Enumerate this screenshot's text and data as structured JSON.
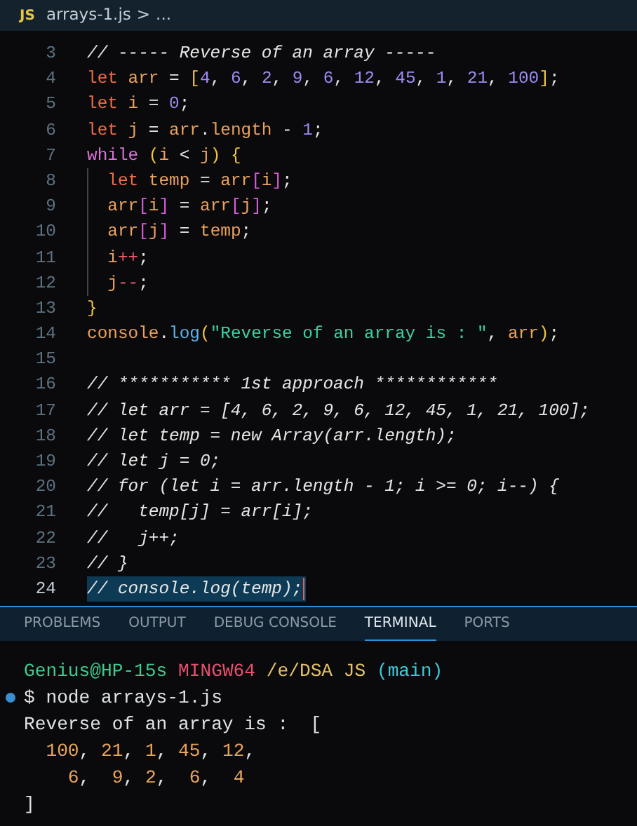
{
  "breadcrumb": {
    "file_icon": "JS",
    "file": "arrays-1.js",
    "separator": ">",
    "more": "..."
  },
  "editor": {
    "lines": [
      {
        "number": "3",
        "tokens": [
          {
            "kind": "comment",
            "text": "// ----- Reverse of an array -----"
          }
        ]
      },
      {
        "number": "4",
        "tokens": [
          {
            "kind": "keyword",
            "text": "let"
          },
          {
            "kind": "variable",
            "text": " arr"
          },
          {
            "kind": "plain",
            "text": " = "
          },
          {
            "kind": "bracket1",
            "text": "["
          },
          {
            "kind": "number",
            "text": "4"
          },
          {
            "kind": "plain",
            "text": ", "
          },
          {
            "kind": "number",
            "text": "6"
          },
          {
            "kind": "plain",
            "text": ", "
          },
          {
            "kind": "number",
            "text": "2"
          },
          {
            "kind": "plain",
            "text": ", "
          },
          {
            "kind": "number",
            "text": "9"
          },
          {
            "kind": "plain",
            "text": ", "
          },
          {
            "kind": "number",
            "text": "6"
          },
          {
            "kind": "plain",
            "text": ", "
          },
          {
            "kind": "number",
            "text": "12"
          },
          {
            "kind": "plain",
            "text": ", "
          },
          {
            "kind": "number",
            "text": "45"
          },
          {
            "kind": "plain",
            "text": ", "
          },
          {
            "kind": "number",
            "text": "1"
          },
          {
            "kind": "plain",
            "text": ", "
          },
          {
            "kind": "number",
            "text": "21"
          },
          {
            "kind": "plain",
            "text": ", "
          },
          {
            "kind": "number",
            "text": "100"
          },
          {
            "kind": "bracket1",
            "text": "]"
          },
          {
            "kind": "plain",
            "text": ";"
          }
        ]
      },
      {
        "number": "5",
        "tokens": [
          {
            "kind": "keyword",
            "text": "let"
          },
          {
            "kind": "variable",
            "text": " i"
          },
          {
            "kind": "plain",
            "text": " = "
          },
          {
            "kind": "number",
            "text": "0"
          },
          {
            "kind": "plain",
            "text": ";"
          }
        ]
      },
      {
        "number": "6",
        "tokens": [
          {
            "kind": "keyword",
            "text": "let"
          },
          {
            "kind": "variable",
            "text": " j"
          },
          {
            "kind": "plain",
            "text": " = "
          },
          {
            "kind": "variable",
            "text": "arr"
          },
          {
            "kind": "plain",
            "text": "."
          },
          {
            "kind": "variable",
            "text": "length"
          },
          {
            "kind": "plain",
            "text": " - "
          },
          {
            "kind": "number",
            "text": "1"
          },
          {
            "kind": "plain",
            "text": ";"
          }
        ]
      },
      {
        "number": "7",
        "tokens": [
          {
            "kind": "control",
            "text": "while"
          },
          {
            "kind": "bracket1",
            "text": " ("
          },
          {
            "kind": "variable",
            "text": "i"
          },
          {
            "kind": "plain",
            "text": " < "
          },
          {
            "kind": "variable",
            "text": "j"
          },
          {
            "kind": "bracket1",
            "text": ")"
          },
          {
            "kind": "bracket1",
            "text": " {"
          }
        ]
      },
      {
        "number": "8",
        "indent_guide": true,
        "tokens": [
          {
            "kind": "keyword",
            "text": "let"
          },
          {
            "kind": "variable",
            "text": " temp"
          },
          {
            "kind": "plain",
            "text": " = "
          },
          {
            "kind": "variable",
            "text": "arr"
          },
          {
            "kind": "bracket2",
            "text": "["
          },
          {
            "kind": "variable",
            "text": "i"
          },
          {
            "kind": "bracket2",
            "text": "]"
          },
          {
            "kind": "plain",
            "text": ";"
          }
        ]
      },
      {
        "number": "9",
        "indent_guide": true,
        "tokens": [
          {
            "kind": "variable",
            "text": "arr"
          },
          {
            "kind": "bracket2",
            "text": "["
          },
          {
            "kind": "variable",
            "text": "i"
          },
          {
            "kind": "bracket2",
            "text": "]"
          },
          {
            "kind": "plain",
            "text": " = "
          },
          {
            "kind": "variable",
            "text": "arr"
          },
          {
            "kind": "bracket2",
            "text": "["
          },
          {
            "kind": "variable",
            "text": "j"
          },
          {
            "kind": "bracket2",
            "text": "]"
          },
          {
            "kind": "plain",
            "text": ";"
          }
        ]
      },
      {
        "number": "10",
        "indent_guide": true,
        "tokens": [
          {
            "kind": "variable",
            "text": "arr"
          },
          {
            "kind": "bracket2",
            "text": "["
          },
          {
            "kind": "variable",
            "text": "j"
          },
          {
            "kind": "bracket2",
            "text": "]"
          },
          {
            "kind": "plain",
            "text": " = "
          },
          {
            "kind": "variable",
            "text": "temp"
          },
          {
            "kind": "plain",
            "text": ";"
          }
        ]
      },
      {
        "number": "11",
        "indent_guide": true,
        "tokens": [
          {
            "kind": "variable",
            "text": "i"
          },
          {
            "kind": "operator",
            "text": "++"
          },
          {
            "kind": "plain",
            "text": ";"
          }
        ]
      },
      {
        "number": "12",
        "indent_guide": true,
        "tokens": [
          {
            "kind": "variable",
            "text": "j"
          },
          {
            "kind": "operator",
            "text": "--"
          },
          {
            "kind": "plain",
            "text": ";"
          }
        ]
      },
      {
        "number": "13",
        "tokens": [
          {
            "kind": "bracket1",
            "text": "}"
          }
        ]
      },
      {
        "number": "14",
        "tokens": [
          {
            "kind": "variable",
            "text": "console"
          },
          {
            "kind": "plain",
            "text": "."
          },
          {
            "kind": "function",
            "text": "log"
          },
          {
            "kind": "bracket1",
            "text": "("
          },
          {
            "kind": "string",
            "text": "\"Reverse of an array is : \""
          },
          {
            "kind": "plain",
            "text": ", "
          },
          {
            "kind": "variable",
            "text": "arr"
          },
          {
            "kind": "bracket1",
            "text": ")"
          },
          {
            "kind": "plain",
            "text": ";"
          }
        ]
      },
      {
        "number": "15"
      },
      {
        "number": "16",
        "tokens": [
          {
            "kind": "comment",
            "text": "// *********** 1st approach ************"
          }
        ]
      },
      {
        "number": "17",
        "tokens": [
          {
            "kind": "comment",
            "text": "// let arr = [4, 6, 2, 9, 6, 12, 45, 1, 21, 100];"
          }
        ]
      },
      {
        "number": "18",
        "tokens": [
          {
            "kind": "comment",
            "text": "// let temp = new Array(arr.length);"
          }
        ]
      },
      {
        "number": "19",
        "tokens": [
          {
            "kind": "comment",
            "text": "// let j = 0;"
          }
        ]
      },
      {
        "number": "20",
        "tokens": [
          {
            "kind": "comment",
            "text": "// for (let i = arr.length - 1; i >= 0; i--) {"
          }
        ]
      },
      {
        "number": "21",
        "tokens": [
          {
            "kind": "comment",
            "text": "//   temp[j] = arr[i];"
          }
        ]
      },
      {
        "number": "22",
        "tokens": [
          {
            "kind": "comment",
            "text": "//   j++;"
          }
        ]
      },
      {
        "number": "23",
        "tokens": [
          {
            "kind": "comment",
            "text": "// }"
          }
        ]
      },
      {
        "number": "24",
        "current": true,
        "tokens": [
          {
            "kind": "comment",
            "text": "// console.log(temp);"
          }
        ]
      }
    ]
  },
  "panel_tabs": [
    {
      "label": "PROBLEMS",
      "selected": false
    },
    {
      "label": "OUTPUT",
      "selected": false
    },
    {
      "label": "DEBUG CONSOLE",
      "selected": false
    },
    {
      "label": "TERMINAL",
      "selected": true
    },
    {
      "label": "PORTS",
      "selected": false
    }
  ],
  "terminal": {
    "lines": [
      {
        "kind": "prompt",
        "segments": [
          {
            "kind": "user",
            "text": "Genius@HP-15s"
          },
          {
            "kind": "host",
            "text": " MINGW64"
          },
          {
            "kind": "path",
            "text": " /e/DSA JS"
          },
          {
            "kind": "branch",
            "text": " (main)"
          }
        ]
      },
      {
        "kind": "command",
        "segments": [
          {
            "kind": "plain",
            "text": "$ node arrays-1.js"
          }
        ]
      },
      {
        "kind": "output",
        "segments": [
          {
            "kind": "plain",
            "text": "Reverse of an array is :  ["
          }
        ]
      },
      {
        "kind": "output",
        "segments": [
          {
            "kind": "number",
            "text": "  100"
          },
          {
            "kind": "plain",
            "text": ", "
          },
          {
            "kind": "number",
            "text": "21"
          },
          {
            "kind": "plain",
            "text": ", "
          },
          {
            "kind": "number",
            "text": "1"
          },
          {
            "kind": "plain",
            "text": ", "
          },
          {
            "kind": "number",
            "text": "45"
          },
          {
            "kind": "plain",
            "text": ", "
          },
          {
            "kind": "number",
            "text": "12"
          },
          {
            "kind": "plain",
            "text": ","
          }
        ]
      },
      {
        "kind": "output",
        "segments": [
          {
            "kind": "number",
            "text": "    6"
          },
          {
            "kind": "plain",
            "text": ",  "
          },
          {
            "kind": "number",
            "text": "9"
          },
          {
            "kind": "plain",
            "text": ", "
          },
          {
            "kind": "number",
            "text": "2"
          },
          {
            "kind": "plain",
            "text": ",  "
          },
          {
            "kind": "number",
            "text": "6"
          },
          {
            "kind": "plain",
            "text": ",  "
          },
          {
            "kind": "number",
            "text": "4"
          }
        ]
      },
      {
        "kind": "output",
        "segments": [
          {
            "kind": "plain",
            "text": "]"
          }
        ]
      }
    ]
  }
}
